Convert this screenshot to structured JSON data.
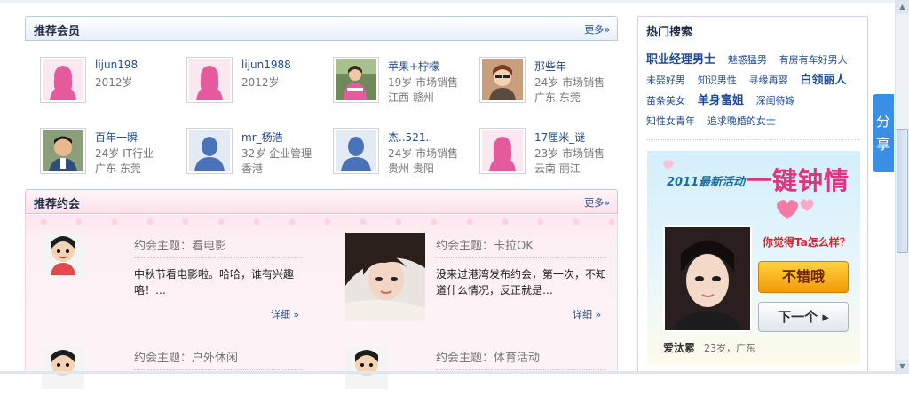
{
  "members_panel": {
    "title": "推荐会员",
    "more": "更多»"
  },
  "members": [
    {
      "name": "lijun198",
      "line2": "2012岁",
      "line3": "",
      "avatar": "female-silhouette-icon"
    },
    {
      "name": "lijun1988",
      "line2": "2012岁",
      "line3": "",
      "avatar": "female-silhouette-icon"
    },
    {
      "name": "苹果+柠檬",
      "line2": "19岁 市场销售",
      "line3": "江西 赣州",
      "avatar": "photo"
    },
    {
      "name": "那些年",
      "line2": "24岁 市场销售",
      "line3": "广东 东莞",
      "avatar": "photo"
    },
    {
      "name": "百年一瞬",
      "line2": "24岁 IT行业",
      "line3": "广东 东莞",
      "avatar": "photo"
    },
    {
      "name": "mr_杨浩",
      "line2": "32岁 企业管理",
      "line3": "香港",
      "avatar": "male-silhouette-icon"
    },
    {
      "name": "杰..521..",
      "line2": "24岁 市场销售",
      "line3": "贵州 贵阳",
      "avatar": "male-silhouette-icon"
    },
    {
      "name": "17厘米_谜",
      "line2": "23岁 市场销售",
      "line3": "云南 丽江",
      "avatar": "female-silhouette-icon"
    }
  ],
  "dates_panel": {
    "title": "推荐约会",
    "more": "更多»"
  },
  "dates": [
    {
      "topic": "约会主题：看电影",
      "desc": "中秋节看电影啦。哈哈，谁有兴趣咯！…",
      "detail": "详细 »"
    },
    {
      "topic": "约会主题：卡拉OK",
      "desc": "没来过港湾发布约会，第一次，不知道什么情况，反正就是…",
      "detail": "详细 »"
    },
    {
      "topic": "约会主题：户外休闲",
      "desc": "",
      "detail": ""
    },
    {
      "topic": "约会主题：体育活动",
      "desc": "",
      "detail": ""
    }
  ],
  "hot_search": {
    "title": "热门搜索",
    "tags": [
      {
        "text": "职业经理男士",
        "size": "big"
      },
      {
        "text": "魅惑猛男",
        "size": "small"
      },
      {
        "text": "有房有车好男人",
        "size": "small"
      },
      {
        "text": "未娶好男",
        "size": "small"
      },
      {
        "text": "知识男性",
        "size": "small"
      },
      {
        "text": "寻缘再婴",
        "size": "small"
      },
      {
        "text": "白领丽人",
        "size": "big"
      },
      {
        "text": "苗条美女",
        "size": "small"
      },
      {
        "text": "单身富姐",
        "size": "big"
      },
      {
        "text": "深闺待嫁",
        "size": "small"
      },
      {
        "text": "知性女青年",
        "size": "small"
      },
      {
        "text": "追求晚婚的女士",
        "size": "small"
      }
    ]
  },
  "promo": {
    "head": "2011最新活动",
    "slogan": "一键钟情",
    "question": "你觉得Ta怎么样？",
    "good_button": "不错哦",
    "next_button": "下一个",
    "caption_name": "爱汰累",
    "caption_info": "23岁，广东"
  },
  "share": {
    "label": "分享"
  },
  "colors": {
    "link": "#1f4b93",
    "pink": "#e2337e",
    "accent": "#3a8ee6"
  }
}
